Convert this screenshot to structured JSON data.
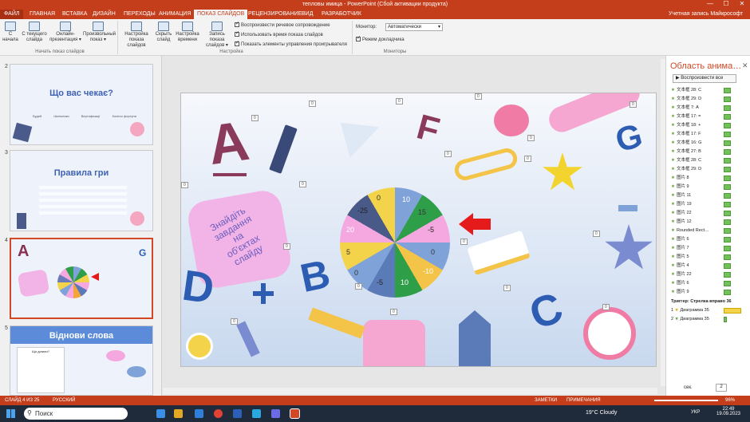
{
  "window": {
    "title": "тепловы имица - PowerPoint (Сбой активации продукта)",
    "min": "—",
    "max": "☐",
    "close": "✕"
  },
  "tabs": [
    "ФАЙЛ",
    "ГЛАВНАЯ",
    "ВСТАВКА",
    "ДИЗАЙН",
    "ПЕРЕХОДЫ",
    "АНИМАЦИЯ",
    "ПОКАЗ СЛАЙДОВ",
    "РЕЦЕНЗИРОВАНИЕ",
    "ВИД",
    "РАЗРАБОТЧИК"
  ],
  "account": "Учетная запись Майкрософт",
  "ribbon": {
    "buttons": [
      {
        "label": "С начала"
      },
      {
        "label": "С текущего слайда"
      },
      {
        "label": "Онлайн-презентация ▾"
      },
      {
        "label": "Произвольный показ ▾"
      },
      {
        "label": "Настройка показа слайдов"
      },
      {
        "label": "Скрыть слайд"
      },
      {
        "label": "Настройка времени"
      },
      {
        "label": "Запись показа слайдов ▾"
      }
    ],
    "checks": [
      "Воспроизвести речевое сопровождение",
      "Использовать время показа слайдов",
      "Показать элементы управления проигрывателя"
    ],
    "monitor_label": "Монитор:",
    "monitor_value": "Автоматически",
    "presenter": "Режим докладчика",
    "groups": [
      "Начать показ слайдов",
      "Настройка",
      "Мониторы"
    ]
  },
  "thumbs": [
    {
      "num": "2",
      "title": "Що вас чекає?",
      "labels": [
        "Будей",
        "Шкільники",
        "Вертифікації",
        "Колесо фортуни"
      ]
    },
    {
      "num": "3",
      "title": "Правила гри"
    },
    {
      "num": "4",
      "title": ""
    },
    {
      "num": "5",
      "title": "Віднови слова",
      "text": "Що ділили?"
    }
  ],
  "slide": {
    "note_lines": [
      "Знайдіть",
      "завдання",
      "на",
      "об'єктах",
      "слайду"
    ],
    "letters": [
      "A",
      "F",
      "G",
      "D",
      "B",
      "C"
    ],
    "wheel": [
      "0",
      "10",
      "15",
      "-5",
      "0",
      "-10",
      "10",
      "-5",
      "0",
      "5",
      "20",
      "-25"
    ],
    "chips": [
      "0",
      "0",
      "0",
      "0",
      "0",
      "0",
      "0",
      "0",
      "0",
      "0",
      "0",
      "0",
      "0",
      "0",
      "0",
      "0",
      "0",
      "0"
    ]
  },
  "pane": {
    "title": "Область анима…",
    "play": "Воспроизвести все",
    "items": [
      "文本框 28: C",
      "文本框 29: D",
      "文本框 7: A",
      "文本框 17: =",
      "文本框 18: +",
      "文本框 17: F",
      "文本框 16: G",
      "文本框 27: B",
      "文本框 28: C",
      "文本框 29: D",
      "图片 8",
      "图片 9",
      "图片 11",
      "图片 19",
      "图片 22",
      "图片 12",
      "Rounded Rect…",
      "图片 6",
      "图片 7",
      "图片 5",
      "图片 4",
      "图片 22",
      "图片 6",
      "图片 9"
    ],
    "trigger": "Триггер: Стрелка вправо 36",
    "trig_items": [
      "Диаграмма 35",
      "Диаграмма 35"
    ],
    "sec": "сек.",
    "page": "2"
  },
  "status": {
    "slide": "СЛАЙД 4 ИЗ 25",
    "lang": "РУССКИЙ",
    "notes": "ЗАМЕТКИ",
    "comments": "ПРИМЕЧАНИЯ",
    "zoom": "96%"
  },
  "taskbar": {
    "search": "Поиск",
    "weather": "19°C  Cloudy",
    "lang": "УКР",
    "time": "22:49",
    "date": "19.09.2023"
  }
}
